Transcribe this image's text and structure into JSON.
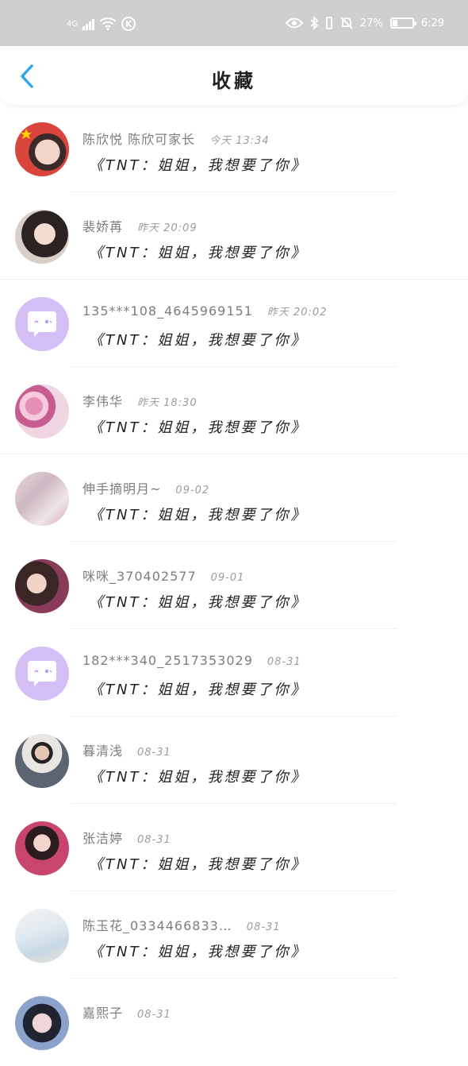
{
  "status_bar": {
    "network": "4G",
    "battery": "27%",
    "time": "6:29",
    "icons": [
      "signal-icon",
      "wifi-icon",
      "k-app-icon",
      "eye-icon",
      "bluetooth-icon",
      "vibrate-icon",
      "mute-bell-icon",
      "battery-icon"
    ]
  },
  "header": {
    "title": "收藏",
    "back_icon": "chevron-left-icon"
  },
  "colors": {
    "accent": "#2ea8e6",
    "status_bar": "#cfcfcf",
    "name": "#7d7d7d",
    "avatar_purple": "#d3bff5"
  },
  "items": [
    {
      "name": "陈欣悦 陈欣可家长",
      "time": "今天 13:34",
      "content": "《TNT：姐姐，我想要了你》",
      "avatar": "photo"
    },
    {
      "name": "裴娇苒",
      "time": "昨天 20:09",
      "content": "《TNT：姐姐，我想要了你》",
      "avatar": "photo"
    },
    {
      "name": "135***108_4645969151",
      "time": "昨天 20:02",
      "content": "《TNT：姐姐，我想要了你》",
      "avatar": "default-chat-icon"
    },
    {
      "name": "李伟华",
      "time": "昨天 18:30",
      "content": "《TNT：姐姐，我想要了你》",
      "avatar": "photo"
    },
    {
      "name": "伸手摘明月~",
      "time": "09-02",
      "content": "《TNT：姐姐，我想要了你》",
      "avatar": "photo"
    },
    {
      "name": "咪咪_370402577",
      "time": "09-01",
      "content": "《TNT：姐姐，我想要了你》",
      "avatar": "photo"
    },
    {
      "name": "182***340_2517353029",
      "time": "08-31",
      "content": "《TNT：姐姐，我想要了你》",
      "avatar": "default-chat-icon"
    },
    {
      "name": "暮清浅",
      "time": "08-31",
      "content": "《TNT：姐姐，我想要了你》",
      "avatar": "photo"
    },
    {
      "name": "张洁婷",
      "time": "08-31",
      "content": "《TNT：姐姐，我想要了你》",
      "avatar": "photo"
    },
    {
      "name": "陈玉花_0334466833…",
      "time": "08-31",
      "content": "《TNT：姐姐，我想要了你》",
      "avatar": "photo"
    },
    {
      "name": "嘉熙子",
      "time": "08-31",
      "content": "",
      "avatar": "photo"
    }
  ]
}
